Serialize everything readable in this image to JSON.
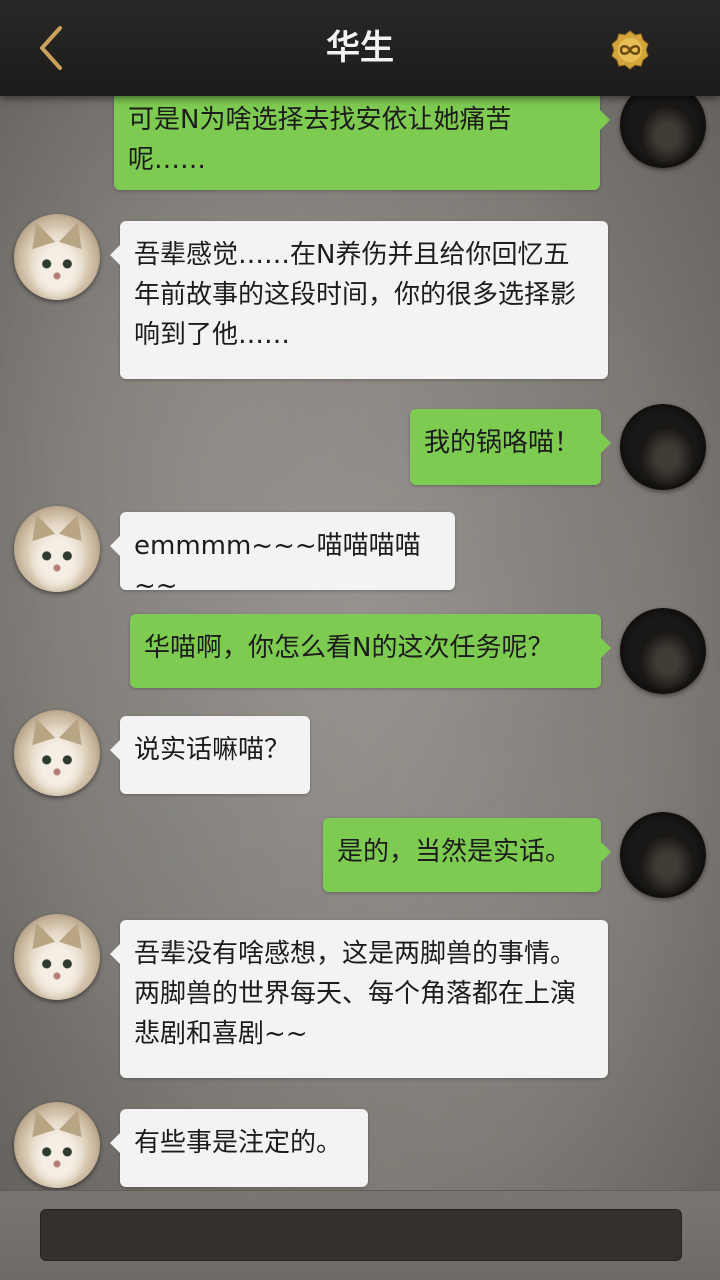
{
  "header": {
    "title": "华生",
    "back_icon": "chevron-left-icon",
    "coin_icon": "infinity-coin-icon",
    "accent": "#c9a15a",
    "bar_color": "#1f1e1d"
  },
  "colors": {
    "incoming_bubble": "#f3f3f3",
    "outgoing_bubble": "#7ecb52",
    "text": "#1c1c1c"
  },
  "messages": [
    {
      "side": "out",
      "avatar": "dark",
      "text": "可是N为啥选择去找安依让她痛苦呢……"
    },
    {
      "side": "in",
      "avatar": "cat",
      "text": "吾辈感觉……在N养伤并且给你回忆五年前故事的这段时间，你的很多选择影响到了他……"
    },
    {
      "side": "out",
      "avatar": "dark",
      "text": "我的锅咯喵！"
    },
    {
      "side": "in",
      "avatar": "cat",
      "text": "emmmm~~~喵喵喵喵~~"
    },
    {
      "side": "out",
      "avatar": "dark",
      "text": "华喵啊，你怎么看N的这次任务呢？"
    },
    {
      "side": "in",
      "avatar": "cat",
      "text": "说实话嘛喵？"
    },
    {
      "side": "out",
      "avatar": "dark",
      "text": "是的，当然是实话。"
    },
    {
      "side": "in",
      "avatar": "cat",
      "text": "吾辈没有啥感想，这是两脚兽的事情。两脚兽的世界每天、每个角落都在上演悲剧和喜剧~~"
    },
    {
      "side": "in",
      "avatar": "cat",
      "text": "有些事是注定的。"
    }
  ],
  "footer": {
    "input_value": ""
  }
}
